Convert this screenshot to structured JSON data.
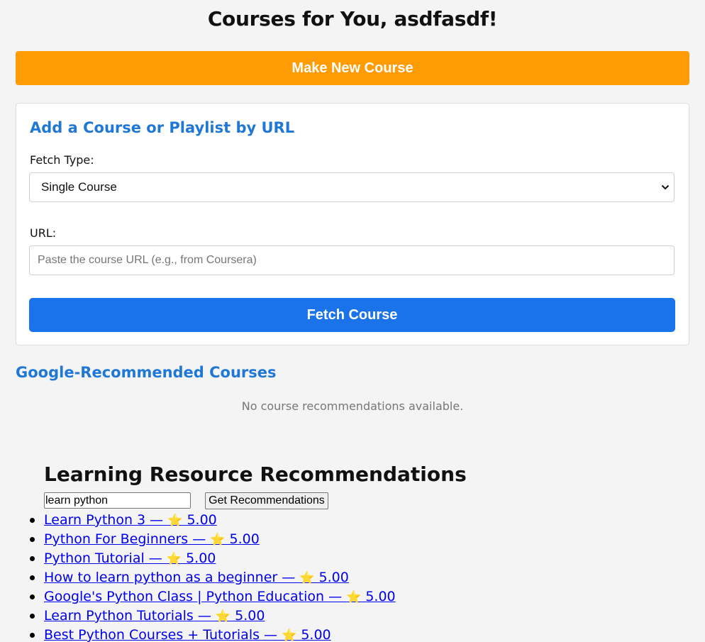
{
  "header": {
    "title": "Courses for You, asdfasdf!"
  },
  "make_course": {
    "label": "Make New Course"
  },
  "add_card": {
    "title": "Add a Course or Playlist by URL",
    "fetch_type_label": "Fetch Type:",
    "fetch_type_selected": "Single Course",
    "url_label": "URL:",
    "url_value": "",
    "url_placeholder": "Paste the course URL (e.g., from Coursera)",
    "fetch_button": "Fetch Course"
  },
  "google_recs": {
    "title": "Google-Recommended Courses",
    "empty_message": "No course recommendations available."
  },
  "learning_resources": {
    "title": "Learning Resource Recommendations",
    "query_value": "learn python",
    "button_label": "Get Recommendations",
    "items": [
      {
        "title": "Learn Python 3",
        "rating": "5.00"
      },
      {
        "title": "Python For Beginners",
        "rating": "5.00"
      },
      {
        "title": "Python Tutorial",
        "rating": "5.00"
      },
      {
        "title": "How to learn python as a beginner",
        "rating": "5.00"
      },
      {
        "title": "Google's Python Class | Python Education",
        "rating": "5.00"
      },
      {
        "title": "Learn Python Tutorials",
        "rating": "5.00"
      },
      {
        "title": "Best Python Courses + Tutorials",
        "rating": "5.00"
      }
    ],
    "separator": " — ",
    "star_icon": "star-icon"
  },
  "colors": {
    "make_button": "#ff9c05",
    "fetch_button": "#1a73e8",
    "heading_blue": "#1f77d6",
    "link": "#0000ee"
  }
}
